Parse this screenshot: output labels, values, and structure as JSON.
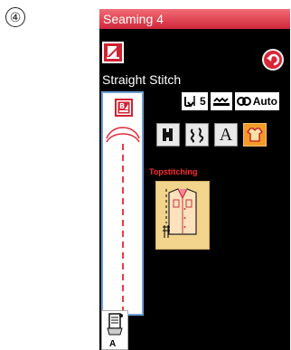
{
  "step_number": "④",
  "header": {
    "title": "Seaming 4"
  },
  "stitch": {
    "name": "Straight Stitch"
  },
  "status": {
    "stitch_length": "5",
    "thread_tension": "Auto"
  },
  "pattern": {
    "category_label": "Topstitching"
  },
  "presser_foot": {
    "label": "A"
  },
  "colors": {
    "title_bar": "#d1273a",
    "accent_red": "#cf2333",
    "preview_border": "#6f9fd6",
    "active_tab": "#f39b2a",
    "pattern_tile": "#f2d48c",
    "label_red": "#ff2b2b"
  },
  "icons": [
    "thread-tension-icon",
    "back-icon",
    "mirror-image-icon",
    "stitch-length-icon",
    "feed-dog-icon",
    "tension-icon",
    "straight-stitch-mode-icon",
    "pattern-stitch-mode-icon",
    "alphabet-mode-icon",
    "utility-stitch-mode-icon",
    "shirt-icon",
    "presser-foot-icon"
  ]
}
